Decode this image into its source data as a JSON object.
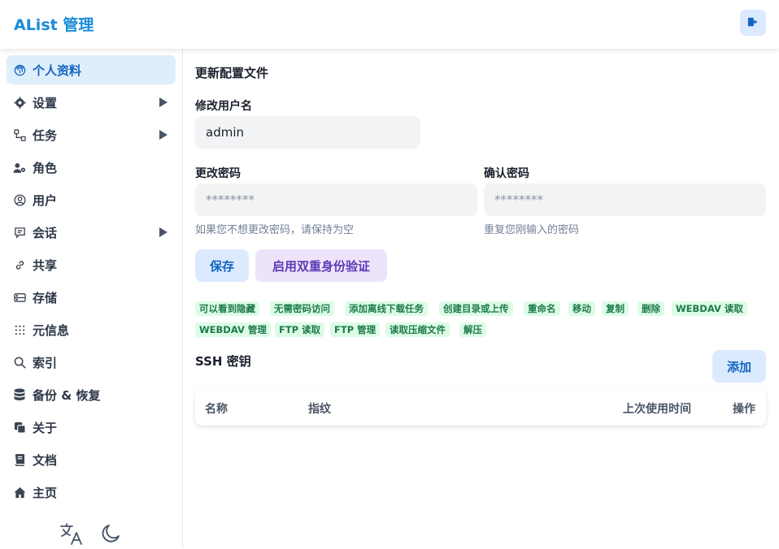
{
  "header": {
    "brand": "AList 管理",
    "logout_icon": "logout-icon"
  },
  "sidebar": {
    "items": [
      {
        "label": "个人资料",
        "icon": "fingerprint-icon",
        "active": true,
        "expandable": false
      },
      {
        "label": "设置",
        "icon": "gear-icon",
        "active": false,
        "expandable": true
      },
      {
        "label": "任务",
        "icon": "workflow-icon",
        "active": false,
        "expandable": true
      },
      {
        "label": "角色",
        "icon": "user-gear-icon",
        "active": false,
        "expandable": false
      },
      {
        "label": "用户",
        "icon": "user-circle-icon",
        "active": false,
        "expandable": false
      },
      {
        "label": "会话",
        "icon": "chat-icon",
        "active": false,
        "expandable": true
      },
      {
        "label": "共享",
        "icon": "link-icon",
        "active": false,
        "expandable": false
      },
      {
        "label": "存储",
        "icon": "storage-icon",
        "active": false,
        "expandable": false
      },
      {
        "label": "元信息",
        "icon": "grid-dots-icon",
        "active": false,
        "expandable": false
      },
      {
        "label": "索引",
        "icon": "search-icon",
        "active": false,
        "expandable": false
      },
      {
        "label": "备份 & 恢复",
        "icon": "database-icon",
        "active": false,
        "expandable": false
      },
      {
        "label": "关于",
        "icon": "copy-icon",
        "active": false,
        "expandable": false
      },
      {
        "label": "文档",
        "icon": "book-icon",
        "active": false,
        "expandable": false
      },
      {
        "label": "主页",
        "icon": "home-icon",
        "active": false,
        "expandable": false
      }
    ],
    "bottom": {
      "language_icon": "translate-icon",
      "theme_icon": "moon-icon"
    }
  },
  "main": {
    "title": "更新配置文件",
    "username_label": "修改用户名",
    "username_value": "admin",
    "password_label": "更改密码",
    "password_placeholder": "********",
    "password_hint": "如果您不想更改密码，请保持为空",
    "confirm_label": "确认密码",
    "confirm_placeholder": "********",
    "confirm_hint": "重复您刚输入的密码",
    "save_button": "保存",
    "twofa_button": "启用双重身份验证",
    "permissions": [
      "可以看到隐藏",
      "无需密码访问",
      "添加离线下载任务",
      "创建目录或上传",
      "重命名",
      "移动",
      "复制",
      "删除",
      "WEBDAV 读取",
      "WEBDAV 管理",
      "FTP 读取",
      "FTP 管理",
      "读取压缩文件",
      "解压"
    ],
    "ssh": {
      "title": "SSH 密钥",
      "add_button": "添加",
      "columns": [
        "名称",
        "指纹",
        "上次使用时间",
        "操作"
      ]
    }
  },
  "colors": {
    "brand": "#1a8cd8",
    "active_bg": "#deeefb",
    "perm_bg": "#dcfce7",
    "perm_text": "#1e7a4a"
  }
}
